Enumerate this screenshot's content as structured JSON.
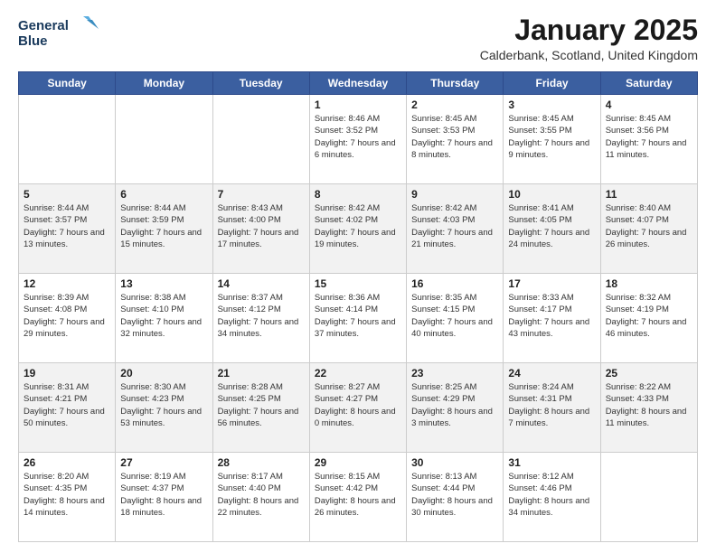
{
  "logo": {
    "line1": "General",
    "line2": "Blue"
  },
  "title": "January 2025",
  "location": "Calderbank, Scotland, United Kingdom",
  "days_of_week": [
    "Sunday",
    "Monday",
    "Tuesday",
    "Wednesday",
    "Thursday",
    "Friday",
    "Saturday"
  ],
  "weeks": [
    [
      {
        "day": "",
        "info": ""
      },
      {
        "day": "",
        "info": ""
      },
      {
        "day": "",
        "info": ""
      },
      {
        "day": "1",
        "info": "Sunrise: 8:46 AM\nSunset: 3:52 PM\nDaylight: 7 hours and 6 minutes."
      },
      {
        "day": "2",
        "info": "Sunrise: 8:45 AM\nSunset: 3:53 PM\nDaylight: 7 hours and 8 minutes."
      },
      {
        "day": "3",
        "info": "Sunrise: 8:45 AM\nSunset: 3:55 PM\nDaylight: 7 hours and 9 minutes."
      },
      {
        "day": "4",
        "info": "Sunrise: 8:45 AM\nSunset: 3:56 PM\nDaylight: 7 hours and 11 minutes."
      }
    ],
    [
      {
        "day": "5",
        "info": "Sunrise: 8:44 AM\nSunset: 3:57 PM\nDaylight: 7 hours and 13 minutes."
      },
      {
        "day": "6",
        "info": "Sunrise: 8:44 AM\nSunset: 3:59 PM\nDaylight: 7 hours and 15 minutes."
      },
      {
        "day": "7",
        "info": "Sunrise: 8:43 AM\nSunset: 4:00 PM\nDaylight: 7 hours and 17 minutes."
      },
      {
        "day": "8",
        "info": "Sunrise: 8:42 AM\nSunset: 4:02 PM\nDaylight: 7 hours and 19 minutes."
      },
      {
        "day": "9",
        "info": "Sunrise: 8:42 AM\nSunset: 4:03 PM\nDaylight: 7 hours and 21 minutes."
      },
      {
        "day": "10",
        "info": "Sunrise: 8:41 AM\nSunset: 4:05 PM\nDaylight: 7 hours and 24 minutes."
      },
      {
        "day": "11",
        "info": "Sunrise: 8:40 AM\nSunset: 4:07 PM\nDaylight: 7 hours and 26 minutes."
      }
    ],
    [
      {
        "day": "12",
        "info": "Sunrise: 8:39 AM\nSunset: 4:08 PM\nDaylight: 7 hours and 29 minutes."
      },
      {
        "day": "13",
        "info": "Sunrise: 8:38 AM\nSunset: 4:10 PM\nDaylight: 7 hours and 32 minutes."
      },
      {
        "day": "14",
        "info": "Sunrise: 8:37 AM\nSunset: 4:12 PM\nDaylight: 7 hours and 34 minutes."
      },
      {
        "day": "15",
        "info": "Sunrise: 8:36 AM\nSunset: 4:14 PM\nDaylight: 7 hours and 37 minutes."
      },
      {
        "day": "16",
        "info": "Sunrise: 8:35 AM\nSunset: 4:15 PM\nDaylight: 7 hours and 40 minutes."
      },
      {
        "day": "17",
        "info": "Sunrise: 8:33 AM\nSunset: 4:17 PM\nDaylight: 7 hours and 43 minutes."
      },
      {
        "day": "18",
        "info": "Sunrise: 8:32 AM\nSunset: 4:19 PM\nDaylight: 7 hours and 46 minutes."
      }
    ],
    [
      {
        "day": "19",
        "info": "Sunrise: 8:31 AM\nSunset: 4:21 PM\nDaylight: 7 hours and 50 minutes."
      },
      {
        "day": "20",
        "info": "Sunrise: 8:30 AM\nSunset: 4:23 PM\nDaylight: 7 hours and 53 minutes."
      },
      {
        "day": "21",
        "info": "Sunrise: 8:28 AM\nSunset: 4:25 PM\nDaylight: 7 hours and 56 minutes."
      },
      {
        "day": "22",
        "info": "Sunrise: 8:27 AM\nSunset: 4:27 PM\nDaylight: 8 hours and 0 minutes."
      },
      {
        "day": "23",
        "info": "Sunrise: 8:25 AM\nSunset: 4:29 PM\nDaylight: 8 hours and 3 minutes."
      },
      {
        "day": "24",
        "info": "Sunrise: 8:24 AM\nSunset: 4:31 PM\nDaylight: 8 hours and 7 minutes."
      },
      {
        "day": "25",
        "info": "Sunrise: 8:22 AM\nSunset: 4:33 PM\nDaylight: 8 hours and 11 minutes."
      }
    ],
    [
      {
        "day": "26",
        "info": "Sunrise: 8:20 AM\nSunset: 4:35 PM\nDaylight: 8 hours and 14 minutes."
      },
      {
        "day": "27",
        "info": "Sunrise: 8:19 AM\nSunset: 4:37 PM\nDaylight: 8 hours and 18 minutes."
      },
      {
        "day": "28",
        "info": "Sunrise: 8:17 AM\nSunset: 4:40 PM\nDaylight: 8 hours and 22 minutes."
      },
      {
        "day": "29",
        "info": "Sunrise: 8:15 AM\nSunset: 4:42 PM\nDaylight: 8 hours and 26 minutes."
      },
      {
        "day": "30",
        "info": "Sunrise: 8:13 AM\nSunset: 4:44 PM\nDaylight: 8 hours and 30 minutes."
      },
      {
        "day": "31",
        "info": "Sunrise: 8:12 AM\nSunset: 4:46 PM\nDaylight: 8 hours and 34 minutes."
      },
      {
        "day": "",
        "info": ""
      }
    ]
  ]
}
